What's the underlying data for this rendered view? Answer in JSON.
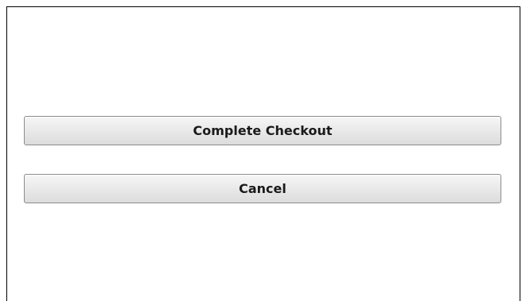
{
  "checkout": {
    "complete_label": "Complete Checkout",
    "cancel_label": "Cancel"
  }
}
